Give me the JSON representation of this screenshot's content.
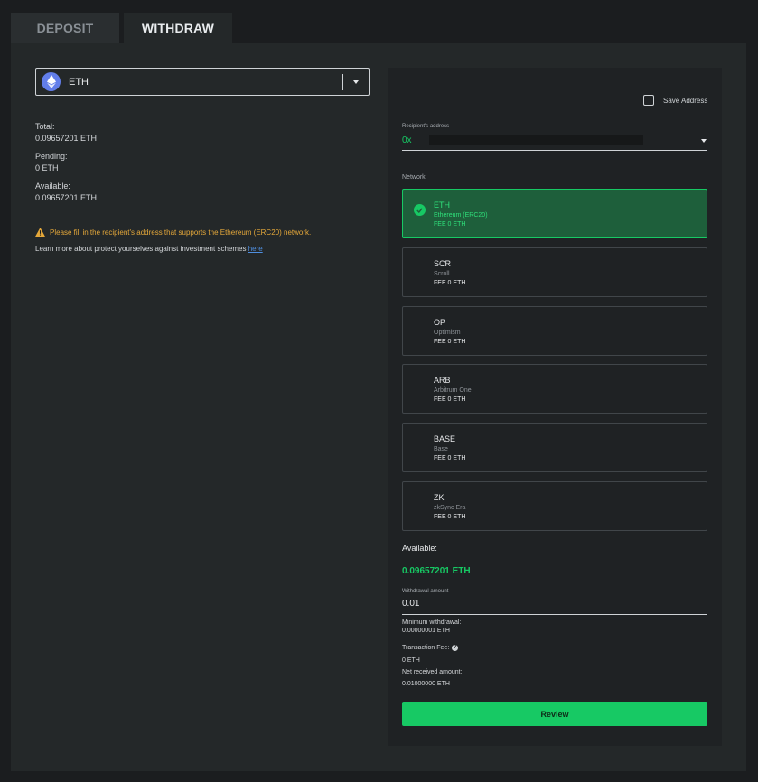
{
  "tabs": {
    "deposit": "DEPOSIT",
    "withdraw": "WITHDRAW"
  },
  "coin": {
    "name": "ETH",
    "icon": "ethereum-icon"
  },
  "balances": {
    "total_label": "Total:",
    "total_value": "0.09657201 ETH",
    "pending_label": "Pending:",
    "pending_value": "0 ETH",
    "available_label": "Available:",
    "available_value": "0.09657201 ETH"
  },
  "warning": "Please fill in the recipient's address that supports the Ethereum (ERC20) network.",
  "learn_more": {
    "text": "Learn more about protect yourselves against investment schemes ",
    "link": "here"
  },
  "save_address": "Save Address",
  "address": {
    "label": "Recipient's address",
    "prefix": "0x"
  },
  "network_label": "Network",
  "networks": [
    {
      "symbol": "ETH",
      "name": "Ethereum (ERC20)",
      "fee": "FEE 0 ETH",
      "selected": true
    },
    {
      "symbol": "SCR",
      "name": "Scroll",
      "fee": "FEE 0 ETH",
      "selected": false
    },
    {
      "symbol": "OP",
      "name": "Optimism",
      "fee": "FEE 0 ETH",
      "selected": false
    },
    {
      "symbol": "ARB",
      "name": "Arbitrum One",
      "fee": "FEE 0 ETH",
      "selected": false
    },
    {
      "symbol": "BASE",
      "name": "Base",
      "fee": "FEE 0 ETH",
      "selected": false
    },
    {
      "symbol": "ZK",
      "name": "zkSync Era",
      "fee": "FEE 0 ETH",
      "selected": false
    }
  ],
  "withdraw": {
    "available_label": "Available:",
    "available_value": "0.09657201 ETH",
    "amount_label": "Withdrawal amount",
    "amount_value": "0.01",
    "min_label": "Minimum withdrawal:",
    "min_value": "0.00000001 ETH",
    "fee_label": "Transaction Fee:",
    "fee_value": "0 ETH",
    "net_label": "Net received amount:",
    "net_value": "0.01000000 ETH",
    "review": "Review"
  },
  "colors": {
    "accent": "#17c964",
    "warning": "#e5a83a",
    "link": "#4f8fe0",
    "eth": "#627eea"
  }
}
